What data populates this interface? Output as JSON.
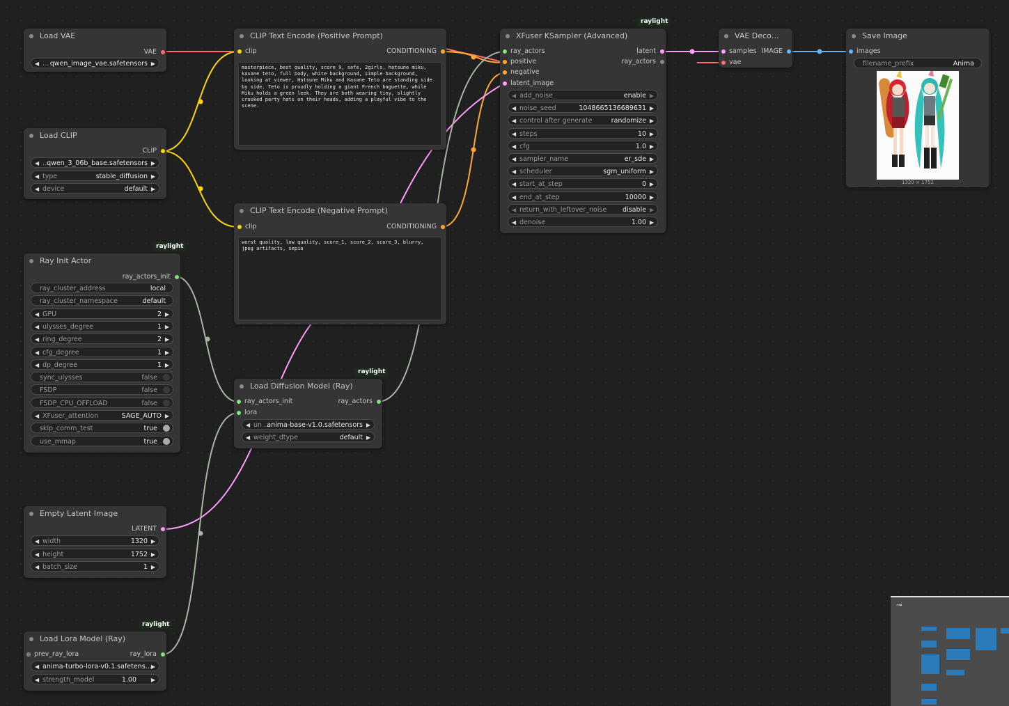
{
  "nodes": {
    "load_vae": {
      "title": "Load VAE",
      "output": "VAE",
      "vae_name": "qwen_image_vae.safetensors",
      "vae_prefix": "…"
    },
    "load_clip": {
      "title": "Load CLIP",
      "output": "CLIP",
      "clip_name": "qwen_3_06b_base.safetensors",
      "clip_prefix": "…",
      "type_label": "type",
      "type_value": "stable_diffusion",
      "device_label": "device",
      "device_value": "default"
    },
    "clip_pos": {
      "title": "CLIP Text Encode (Positive Prompt)",
      "input": "clip",
      "output": "CONDITIONING",
      "text": "masterpiece, best quality, score_9, safe, 2girls, hatsune miku, kasane teto, full body, white background, simple background, looking at viewer, Hatsune Miku and Kasane Teto are standing side by side. Teto is proudly holding a giant French baguette, while Miku holds a green leek. They are both wearing tiny, slightly crooked party hats on their heads, adding a playful vibe to the scene."
    },
    "clip_neg": {
      "title": "CLIP Text Encode (Negative Prompt)",
      "input": "clip",
      "output": "CONDITIONING",
      "text": "worst quality, low quality, score_1, score_2, score_3, blurry, jpeg artifacts, sepia"
    },
    "ksampler": {
      "badge": "raylight",
      "title": "XFuser KSampler (Advanced)",
      "inputs": [
        "ray_actors",
        "positive",
        "negative",
        "latent_image"
      ],
      "outputs": [
        "latent",
        "ray_actors"
      ],
      "widgets": [
        {
          "label": "add_noise",
          "value": "enable"
        },
        {
          "label": "noise_seed",
          "value": "1048665136689631"
        },
        {
          "label": "control after generate",
          "value": "randomize"
        },
        {
          "label": "steps",
          "value": "10"
        },
        {
          "label": "cfg",
          "value": "1.0"
        },
        {
          "label": "sampler_name",
          "value": "er_sde"
        },
        {
          "label": "scheduler",
          "value": "sgm_uniform"
        },
        {
          "label": "start_at_step",
          "value": "0"
        },
        {
          "label": "end_at_step",
          "value": "10000"
        },
        {
          "label": "return_with_leftover_noise",
          "value": "disable"
        },
        {
          "label": "denoise",
          "value": "1.00"
        }
      ]
    },
    "vae_decode": {
      "title": "VAE Deco…",
      "inputs": [
        "samples",
        "vae"
      ],
      "output": "IMAGE"
    },
    "save_image": {
      "title": "Save Image",
      "input": "images",
      "prefix_label": "filename_prefix",
      "prefix_value": "Anima",
      "image_size": "1320 × 1752"
    },
    "ray_init": {
      "badge": "raylight",
      "title": "Ray Init Actor",
      "output": "ray_actors_init",
      "widgets": [
        {
          "label": "ray_cluster_address",
          "value": "local",
          "kind": "text"
        },
        {
          "label": "ray_cluster_namespace",
          "value": "default",
          "kind": "text"
        },
        {
          "label": "GPU",
          "value": "2",
          "kind": "number"
        },
        {
          "label": "ulysses_degree",
          "value": "1",
          "kind": "number"
        },
        {
          "label": "ring_degree",
          "value": "2",
          "kind": "number"
        },
        {
          "label": "cfg_degree",
          "value": "1",
          "kind": "number"
        },
        {
          "label": "dp_degree",
          "value": "1",
          "kind": "number"
        },
        {
          "label": "sync_ulysses",
          "value": "false",
          "kind": "toggle"
        },
        {
          "label": "FSDP",
          "value": "false",
          "kind": "toggle"
        },
        {
          "label": "FSDP_CPU_OFFLOAD",
          "value": "false",
          "kind": "toggle"
        },
        {
          "label": "XFuser_attention",
          "value": "SAGE_AUTO",
          "kind": "combo"
        },
        {
          "label": "skip_comm_test",
          "value": "true",
          "kind": "toggle"
        },
        {
          "label": "use_mmap",
          "value": "true",
          "kind": "toggle"
        }
      ]
    },
    "load_diffusion": {
      "badge": "raylight",
      "title": "Load Diffusion Model (Ray)",
      "inputs": [
        "ray_actors_init",
        "lora"
      ],
      "output": "ray_actors",
      "unet_prefix": "un …",
      "unet_name": "anima-base-v1.0.safetensors",
      "dtype_label": "weight_dtype",
      "dtype_value": "default"
    },
    "empty_latent": {
      "title": "Empty Latent Image",
      "output": "LATENT",
      "widgets": [
        {
          "label": "width",
          "value": "1320"
        },
        {
          "label": "height",
          "value": "1752"
        },
        {
          "label": "batch_size",
          "value": "1"
        }
      ]
    },
    "load_lora": {
      "badge": "raylight",
      "title": "Load Lora Model (Ray)",
      "input": "prev_ray_lora",
      "output": "ray_lora",
      "lora_name": "anima-turbo-lora-v0.1.safetens…",
      "strength_label": "strength_model",
      "strength_value": "1.00"
    }
  },
  "colors": {
    "vae": "#ff6e6e",
    "clip": "#ffd500",
    "conditioning": "#ffa931",
    "latent": "#ff9cf9",
    "image": "#64b5f6",
    "ray": "#8fa88f"
  }
}
